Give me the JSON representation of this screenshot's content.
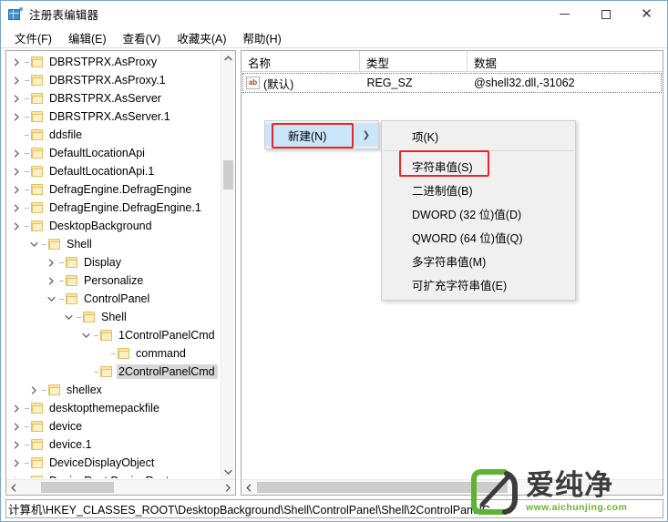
{
  "window": {
    "title": "注册表编辑器",
    "app_icon": "registry-icon",
    "minimize_label": "最小化",
    "maximize_label": "最大化",
    "close_label": "关闭"
  },
  "menubar": {
    "items": [
      {
        "label": "文件(F)"
      },
      {
        "label": "编辑(E)"
      },
      {
        "label": "查看(V)"
      },
      {
        "label": "收藏夹(A)"
      },
      {
        "label": "帮助(H)"
      }
    ]
  },
  "tree": {
    "items": [
      {
        "label": "DBRSTPRX.AsProxy",
        "indent": 0,
        "state": "collapsed"
      },
      {
        "label": "DBRSTPRX.AsProxy.1",
        "indent": 0,
        "state": "collapsed"
      },
      {
        "label": "DBRSTPRX.AsServer",
        "indent": 0,
        "state": "collapsed"
      },
      {
        "label": "DBRSTPRX.AsServer.1",
        "indent": 0,
        "state": "collapsed"
      },
      {
        "label": "ddsfile",
        "indent": 0,
        "state": "leaf"
      },
      {
        "label": "DefaultLocationApi",
        "indent": 0,
        "state": "collapsed"
      },
      {
        "label": "DefaultLocationApi.1",
        "indent": 0,
        "state": "collapsed"
      },
      {
        "label": "DefragEngine.DefragEngine",
        "indent": 0,
        "state": "collapsed"
      },
      {
        "label": "DefragEngine.DefragEngine.1",
        "indent": 0,
        "state": "collapsed"
      },
      {
        "label": "DesktopBackground",
        "indent": 0,
        "state": "collapsed"
      },
      {
        "label": "Shell",
        "indent": 1,
        "state": "expanded"
      },
      {
        "label": "Display",
        "indent": 2,
        "state": "collapsed"
      },
      {
        "label": "Personalize",
        "indent": 2,
        "state": "collapsed"
      },
      {
        "label": "ControlPanel",
        "indent": 2,
        "state": "expanded"
      },
      {
        "label": "Shell",
        "indent": 3,
        "state": "expanded"
      },
      {
        "label": "1ControlPanelCmd",
        "indent": 4,
        "state": "expanded"
      },
      {
        "label": "command",
        "indent": 5,
        "state": "leaf"
      },
      {
        "label": "2ControlPanelCmd",
        "indent": 4,
        "state": "leaf",
        "selected": true
      },
      {
        "label": "shellex",
        "indent": 1,
        "state": "collapsed"
      },
      {
        "label": "desktopthemepackfile",
        "indent": 0,
        "state": "collapsed"
      },
      {
        "label": "device",
        "indent": 0,
        "state": "collapsed"
      },
      {
        "label": "device.1",
        "indent": 0,
        "state": "collapsed"
      },
      {
        "label": "DeviceDisplayObject",
        "indent": 0,
        "state": "collapsed"
      },
      {
        "label": "DeviceRect.DeviceRect",
        "indent": 0,
        "state": "collapsed"
      }
    ],
    "scroll_up_icon": "chevron-up-icon",
    "scroll_down_icon": "chevron-down-icon",
    "scroll_left_icon": "chevron-left-icon",
    "scroll_right_icon": "chevron-right-icon"
  },
  "value_list": {
    "columns": [
      "名称",
      "类型",
      "数据"
    ],
    "rows": [
      {
        "name": "(默认)",
        "type": "REG_SZ",
        "data": "@shell32.dll,-31062",
        "icon": "ab-string-icon"
      }
    ]
  },
  "context_menu": {
    "parent": {
      "label": "新建(N)",
      "submenu_arrow": "chevron-right-icon"
    },
    "submenu": {
      "items": [
        {
          "label": "项(K)"
        },
        {
          "label": "字符串值(S)",
          "highlighted": true
        },
        {
          "label": "二进制值(B)"
        },
        {
          "label": "DWORD (32 位)值(D)"
        },
        {
          "label": "QWORD (64 位)值(Q)"
        },
        {
          "label": "多字符串值(M)"
        },
        {
          "label": "可扩充字符串值(E)"
        }
      ]
    }
  },
  "annotations": {
    "highlight_color": "#e8262a",
    "boxes": [
      "新建(N)",
      "字符串值(S)"
    ]
  },
  "statusbar": {
    "path": "计算机\\HKEY_CLASSES_ROOT\\DesktopBackground\\Shell\\ControlPanel\\Shell\\2ControlPanelC"
  },
  "watermark": {
    "brand": "爱纯净",
    "url": "www.aichunjing.com",
    "accent_color": "#6ab42e",
    "text_color": "#3c3c3c"
  }
}
